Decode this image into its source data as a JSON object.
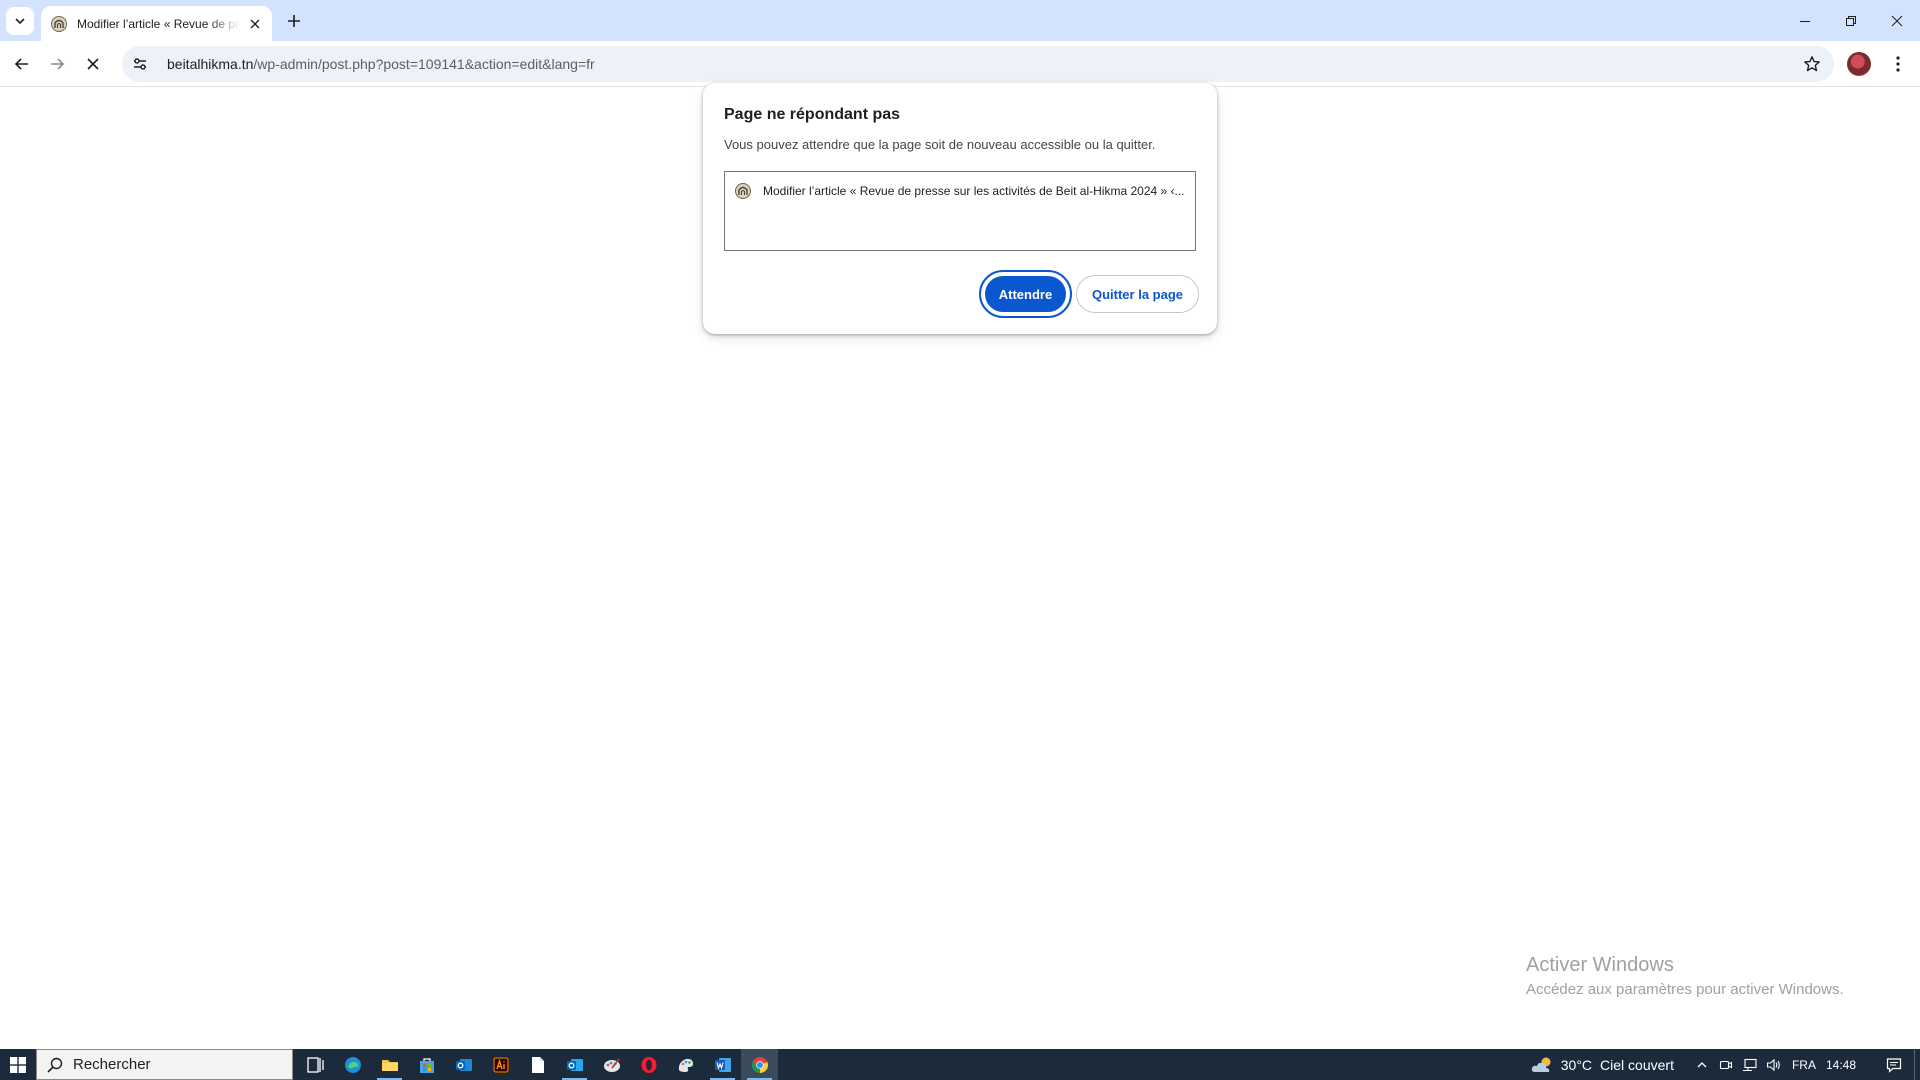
{
  "browser": {
    "tab": {
      "title": "Modifier l’article « Revue de presse sur les activités de Beit al-Hikma 2024 »"
    },
    "address_bar": {
      "host": "beitalhikma.tn",
      "path": "/wp-admin/post.php?post=109141&action=edit&lang=fr"
    }
  },
  "dialog": {
    "title": "Page ne répondant pas",
    "message": "Vous pouvez attendre que la page soit de nouveau accessible ou la quitter.",
    "pages": [
      {
        "label": "Modifier l’article « Revue de presse sur les activités de Beit al-Hikma 2024 » ‹..."
      }
    ],
    "wait_label": "Attendre",
    "quit_label": "Quitter la page"
  },
  "watermark": {
    "title": "Activer Windows",
    "subtitle": "Accédez aux paramètres pour activer Windows."
  },
  "taskbar": {
    "search_placeholder": "Rechercher",
    "weather_temp": "30°C",
    "weather_desc": "Ciel couvert",
    "language": "FRA",
    "time": "14:48"
  },
  "colors": {
    "accent": "#0b57d0",
    "tab_strip": "#d3e3fd",
    "omnibox": "#edf2fa",
    "taskbar": "#1c2b3b"
  }
}
